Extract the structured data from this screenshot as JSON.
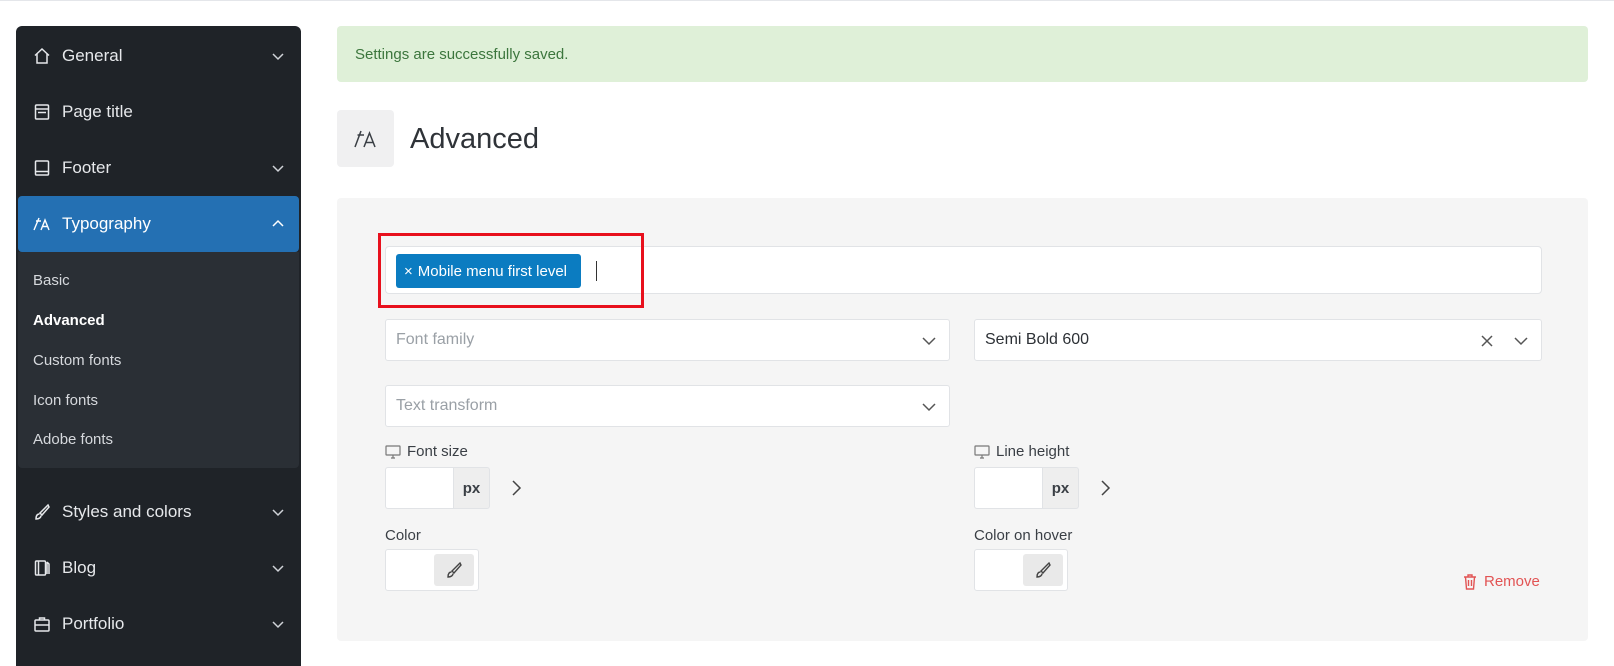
{
  "sidebar": {
    "items": [
      {
        "label": "General",
        "icon": "home-icon"
      },
      {
        "label": "Page title",
        "icon": "page-icon"
      },
      {
        "label": "Footer",
        "icon": "footer-icon"
      },
      {
        "label": "Typography",
        "icon": "typography-icon"
      },
      {
        "label": "Styles and colors",
        "icon": "brush-icon"
      },
      {
        "label": "Blog",
        "icon": "blog-icon"
      },
      {
        "label": "Portfolio",
        "icon": "briefcase-icon"
      }
    ],
    "typography_submenu": [
      "Basic",
      "Advanced",
      "Custom fonts",
      "Icon fonts",
      "Adobe fonts"
    ],
    "active_item": "Typography",
    "current_subitem": "Advanced",
    "accent_color": "#2470b3"
  },
  "alert": {
    "message": "Settings are successfully saved.",
    "color": "#dff0d8"
  },
  "page": {
    "title": "Advanced",
    "icon": "typography-icon"
  },
  "selector": {
    "tag": "Mobile menu first level",
    "tag_remove_symbol": "×"
  },
  "fields": {
    "font_family_placeholder": "Font family",
    "font_weight_value": "Semi Bold 600",
    "text_transform_placeholder": "Text transform",
    "font_size_label": "Font size",
    "font_size_unit": "px",
    "line_height_label": "Line height",
    "line_height_unit": "px",
    "color_label": "Color",
    "color_hover_label": "Color on hover"
  },
  "actions": {
    "remove_label": "Remove"
  }
}
